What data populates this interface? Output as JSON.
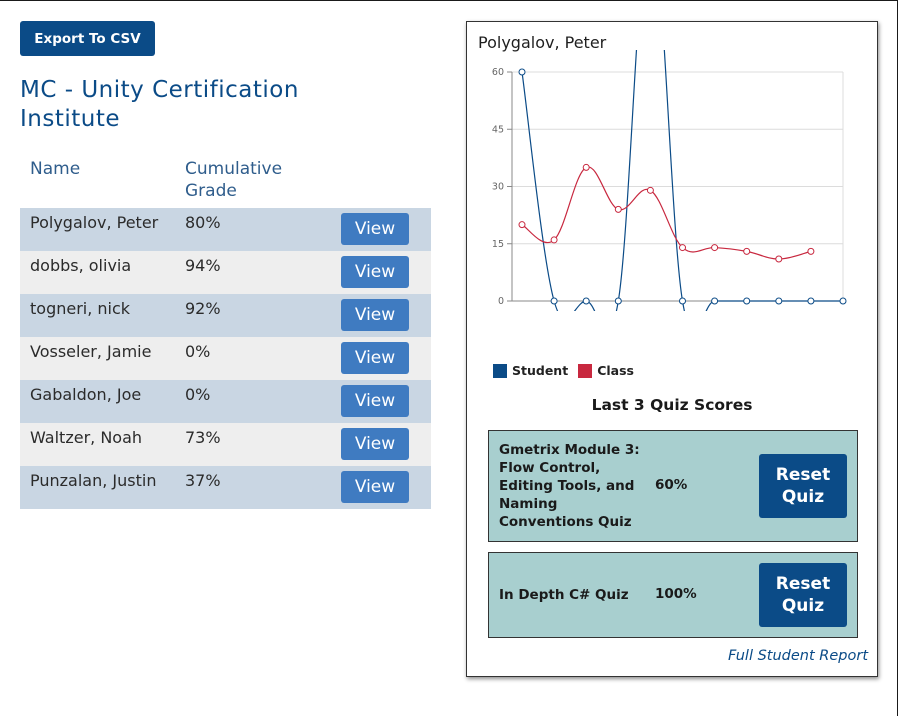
{
  "toolbar": {
    "export_label": "Export To CSV"
  },
  "org": {
    "title": "MC - Unity Certification Institute"
  },
  "grid": {
    "headers": {
      "name": "Name",
      "grade": "Cumulative Grade"
    },
    "view_label": "View",
    "rows": [
      {
        "name": "Polygalov, Peter",
        "grade": "80%"
      },
      {
        "name": "dobbs, olivia",
        "grade": "94%"
      },
      {
        "name": "togneri, nick",
        "grade": "92%"
      },
      {
        "name": "Vosseler, Jamie",
        "grade": "0%"
      },
      {
        "name": "Gabaldon, Joe",
        "grade": "0%"
      },
      {
        "name": "Waltzer, Noah",
        "grade": "73%"
      },
      {
        "name": "Punzalan, Justin",
        "grade": "37%"
      }
    ]
  },
  "panel": {
    "student_name": "Polygalov, Peter",
    "quiz_section_title": "Last 3 Quiz Scores",
    "full_report_label": "Full Student Report",
    "quizzes": [
      {
        "name": "Gmetrix Module 3: Flow Control, Editing Tools, and Naming Conventions Quiz",
        "score": "60%",
        "reset_label": "Reset Quiz"
      },
      {
        "name": "In Depth C# Quiz",
        "score": "100%",
        "reset_label": "Reset Quiz"
      }
    ]
  },
  "chart_data": {
    "type": "line",
    "title": "",
    "xlabel": "",
    "ylabel": "",
    "ylim": [
      0,
      60
    ],
    "yticks": [
      0,
      15,
      30,
      45,
      60
    ],
    "grid": true,
    "legend_position": "bottom-left",
    "x": [
      1,
      2,
      3,
      4,
      5,
      6,
      7,
      8,
      9,
      10,
      11
    ],
    "series": [
      {
        "name": "Student",
        "color": "#0b4b87",
        "values": [
          60,
          0,
          0,
          0,
          100,
          0,
          0,
          0,
          0,
          0,
          0
        ]
      },
      {
        "name": "Class",
        "color": "#c8283f",
        "values": [
          20,
          16,
          35,
          24,
          29,
          14,
          14,
          13,
          11,
          13,
          null
        ]
      }
    ]
  },
  "colors": {
    "accent": "#0b4b87",
    "view_button": "#3f7bc1",
    "quiz_card": "#a8cfcf"
  }
}
